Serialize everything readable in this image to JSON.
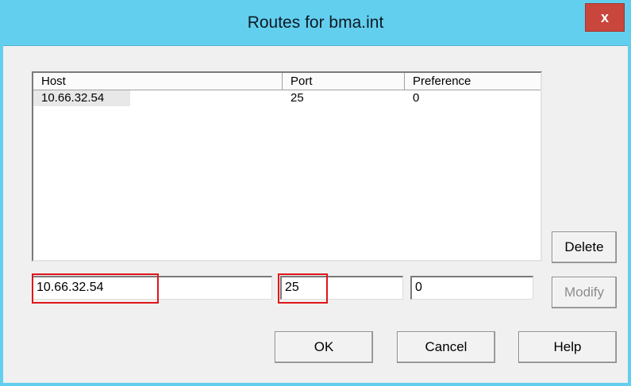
{
  "window": {
    "title": "Routes for bma.int",
    "close_label": "x"
  },
  "list": {
    "columns": [
      "Host",
      "Port",
      "Preference"
    ],
    "rows": [
      {
        "host": "10.66.32.54",
        "port": "25",
        "preference": "0"
      }
    ]
  },
  "form": {
    "host_value": "10.66.32.54",
    "port_value": "25",
    "preference_value": "0"
  },
  "buttons": {
    "delete": "Delete",
    "modify": "Modify",
    "ok": "OK",
    "cancel": "Cancel",
    "help": "Help"
  },
  "colors": {
    "titlebar": "#63cfee",
    "close": "#c9463d",
    "highlight": "#e0161a"
  }
}
